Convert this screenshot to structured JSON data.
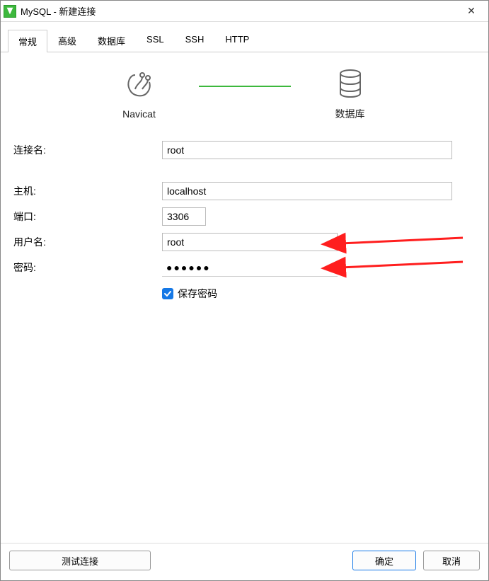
{
  "window": {
    "title": "MySQL - 新建连接"
  },
  "tabs": [
    {
      "label": "常规",
      "active": true
    },
    {
      "label": "高级"
    },
    {
      "label": "数据库"
    },
    {
      "label": "SSL"
    },
    {
      "label": "SSH"
    },
    {
      "label": "HTTP"
    }
  ],
  "connector": {
    "left_label": "Navicat",
    "right_label": "数据库"
  },
  "form": {
    "conn_name_label": "连接名:",
    "conn_name_value": "root",
    "host_label": "主机:",
    "host_value": "localhost",
    "port_label": "端口:",
    "port_value": "3306",
    "user_label": "用户名:",
    "user_value": "root",
    "password_label": "密码:",
    "password_value": "●●●●●●",
    "save_pw_label": "保存密码",
    "save_pw_checked": true
  },
  "buttons": {
    "test": "测试连接",
    "ok": "确定",
    "cancel": "取消"
  }
}
